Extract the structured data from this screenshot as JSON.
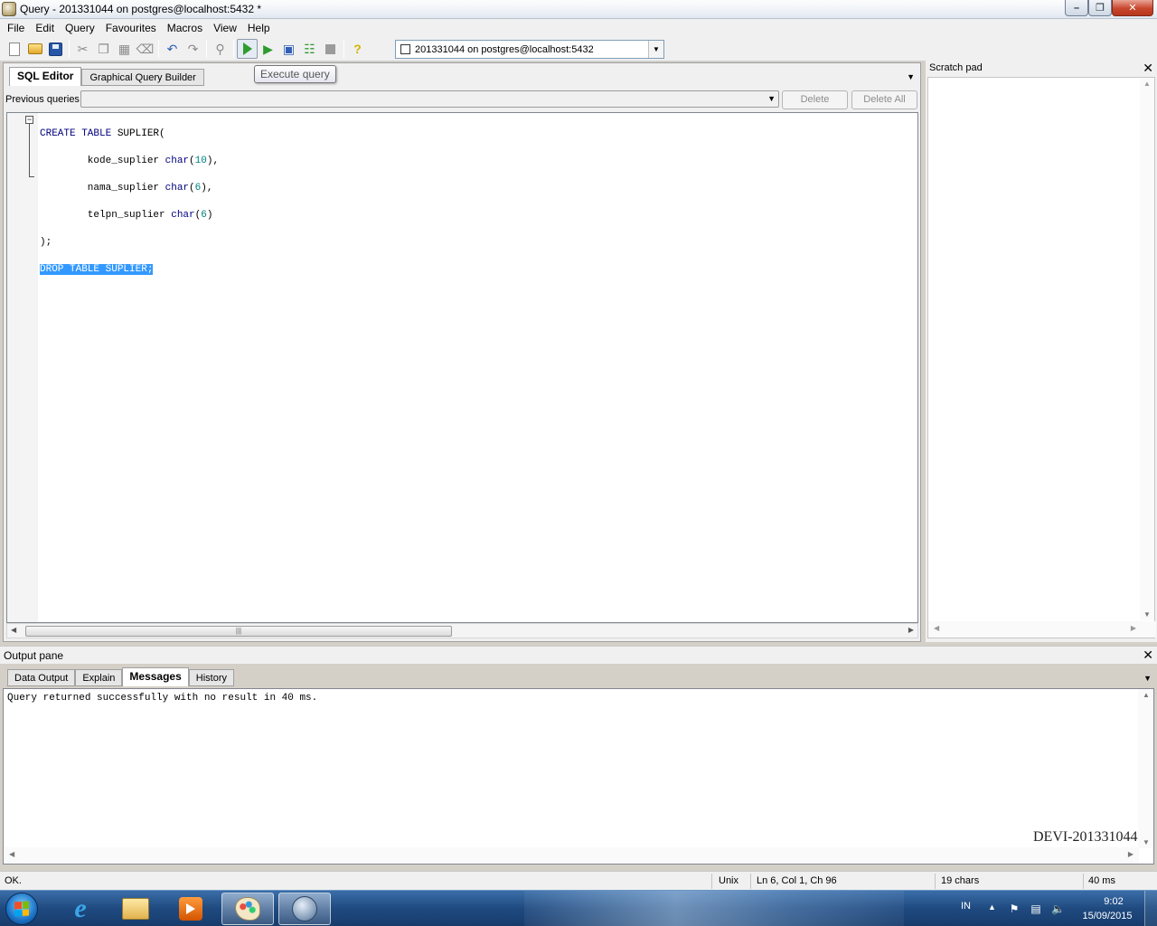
{
  "window": {
    "title": "Query - 201331044 on postgres@localhost:5432 *"
  },
  "menu": [
    "File",
    "Edit",
    "Query",
    "Favourites",
    "Macros",
    "View",
    "Help"
  ],
  "toolbar": {
    "connection": "201331044 on postgres@localhost:5432",
    "tooltip": "Execute query"
  },
  "editor": {
    "tabs": [
      "SQL Editor",
      "Graphical Query Builder"
    ],
    "previous_queries_label": "Previous queries",
    "delete_label": "Delete",
    "delete_all_label": "Delete All",
    "code": {
      "l1_kw": "CREATE TABLE",
      "l1_rest": " SUPLIER(",
      "l2_name": "        kode_suplier ",
      "l2_type": "char",
      "l2_open": "(",
      "l2_num": "10",
      "l2_close": "),",
      "l3_name": "        nama_suplier ",
      "l3_type": "char",
      "l3_open": "(",
      "l3_num": "6",
      "l3_close": "),",
      "l4_name": "        telpn_suplier ",
      "l4_type": "char",
      "l4_open": "(",
      "l4_num": "6",
      "l4_close": ")",
      "l5": ");",
      "l6_selected": "DROP TABLE SUPLIER;"
    }
  },
  "scratch_pad": {
    "title": "Scratch pad"
  },
  "output": {
    "title": "Output pane",
    "tabs": [
      "Data Output",
      "Explain",
      "Messages",
      "History"
    ],
    "message": "Query returned successfully with no result in 40 ms.",
    "watermark": "DEVI-201331044"
  },
  "status": {
    "state": "OK.",
    "line_ending": "Unix",
    "position": "Ln 6, Col 1, Ch 96",
    "chars": "19 chars",
    "time": "40 ms"
  },
  "taskbar": {
    "lang": "IN",
    "time": "9:02",
    "date": "15/09/2015"
  }
}
